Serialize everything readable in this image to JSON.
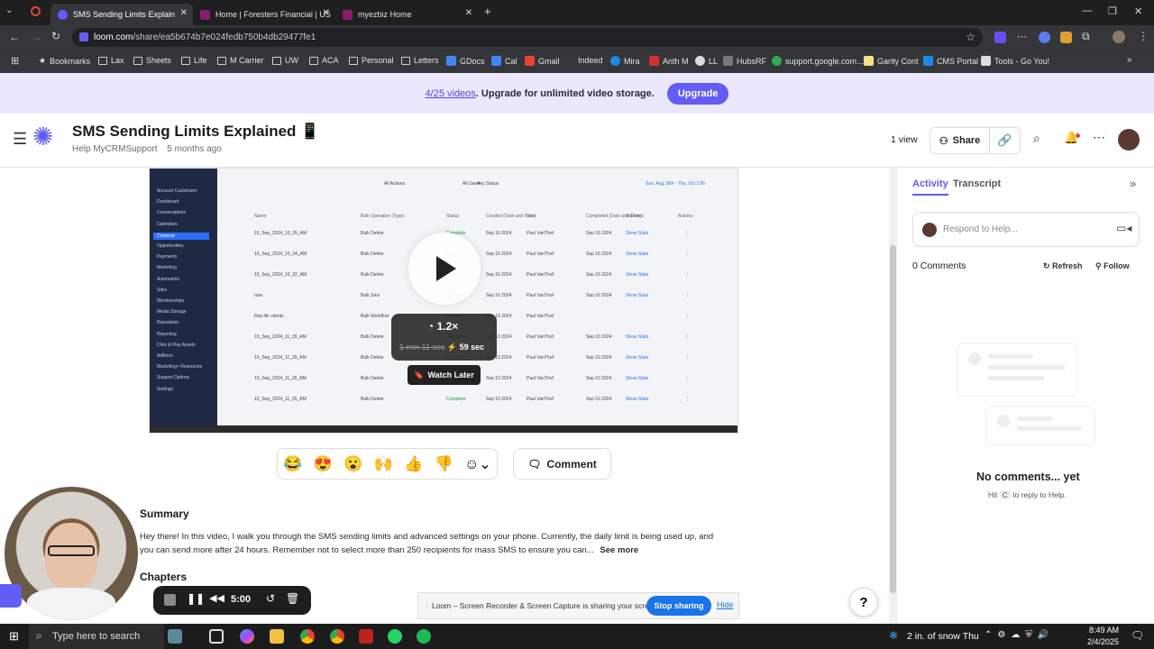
{
  "browser": {
    "tabs": [
      {
        "title": "SMS Sending Limits Explain",
        "active": true
      },
      {
        "title": "Home | Foresters Financial | US",
        "active": false
      },
      {
        "title": "myezbiz Home",
        "active": false
      }
    ],
    "url_host": "loom.com",
    "url_path": "/share/ea5b674b7e024fedb750b4db29477fe1",
    "bookmarks": [
      "Bookmarks",
      "Lax",
      "Sheets",
      "Life",
      "M Carrier",
      "UW",
      "ACA",
      "Personal",
      "Letters",
      "GDocs",
      "Cal",
      "Gmail",
      "Indeed",
      "Mira",
      "Anth M",
      "LL",
      "HubsRF",
      "support.google.com...",
      "Garity Cont",
      "CMS Portal",
      "Tools - Go You!"
    ]
  },
  "banner": {
    "count": "4/25 videos",
    "message": ". Upgrade for unlimited video storage.",
    "upgrade_label": "Upgrade"
  },
  "header": {
    "title": "SMS Sending Limits Explained 📱",
    "author": "Help MyCRMSupport",
    "age": "5 months ago",
    "views": "1 view",
    "share_label": "Share"
  },
  "video": {
    "speed": "1.2×",
    "original_time": "1 min 11 sec",
    "new_time": "59 sec",
    "watch_later": "Watch Later",
    "sidebar_items": [
      "Account Customizer",
      "Dashboard",
      "Conversations",
      "Calendars",
      "Contacts",
      "Opportunities",
      "Payments",
      "Marketing",
      "Automation",
      "Sites",
      "Memberships",
      "Media Storage",
      "Reputation",
      "Reporting",
      "Click & Play Assets",
      "AdBoon",
      "Marketing+ Resources",
      "Support Options",
      "Settings"
    ],
    "columns": [
      "Name",
      "Bulk Operation (Type)",
      "Status",
      "Created (Date and Time)",
      "User",
      "Completed (Date and Time)",
      "Statistics",
      "Actions"
    ],
    "filters": [
      "All Actions",
      "All Users",
      "Any Status",
      "Sun, Aug 18th - Thu, Oct 17th"
    ],
    "rows": [
      {
        "name": "16_Sep_2024_10_35_AM",
        "op": "Bulk Delete",
        "status": "Complete",
        "created": "Sep 16 2024",
        "user": "Paul VanThof",
        "completed": "Sep 16 2024",
        "stats": "Show Stats"
      },
      {
        "name": "16_Sep_2024_10_34_AM",
        "op": "Bulk Delete",
        "status": "Complete",
        "created": "Sep 16 2024",
        "user": "Paul VanThof",
        "completed": "Sep 16 2024",
        "stats": "Show Stats"
      },
      {
        "name": "16_Sep_2024_10_32_AM",
        "op": "Bulk Delete",
        "status": "Complete",
        "created": "Sep 16 2024",
        "user": "Paul VanThof",
        "completed": "Sep 16 2024",
        "stats": "Show Stats"
      },
      {
        "name": "now",
        "op": "Bulk Sms",
        "status": "Complete",
        "created": "Sep 16 2024",
        "user": "Paul VanThof",
        "completed": "Sep 16 2024",
        "stats": "Show Stats"
      },
      {
        "name": "Rep life clients",
        "op": "Bulk Workflow",
        "status": "Queued",
        "created": "Sep 16 2024",
        "user": "Paul VanThof",
        "completed": "",
        "stats": ""
      },
      {
        "name": "10_Sep_2024_11_29_AM",
        "op": "Bulk Delete",
        "status": "Complete",
        "created": "Sep 10 2024",
        "user": "Paul VanThof",
        "completed": "Sep 10 2024",
        "stats": "Show Stats"
      },
      {
        "name": "10_Sep_2024_11_29_AM",
        "op": "Bulk Delete",
        "status": "Complete",
        "created": "Sep 10 2024",
        "user": "Paul VanThof",
        "completed": "Sep 10 2024",
        "stats": "Show Stats"
      },
      {
        "name": "10_Sep_2024_11_26_AM",
        "op": "Bulk Delete",
        "status": "Complete",
        "created": "Sep 10 2024",
        "user": "Paul VanThof",
        "completed": "Sep 10 2024",
        "stats": "Show Stats"
      },
      {
        "name": "10_Sep_2024_11_25_AM",
        "op": "Bulk Delete",
        "status": "Complete",
        "created": "Sep 10 2024",
        "user": "Paul VanThof",
        "completed": "Sep 10 2024",
        "stats": "Show Stats"
      }
    ]
  },
  "reactions": [
    "😂",
    "😍",
    "😮",
    "🙌",
    "👍",
    "👎"
  ],
  "comment_label": "Comment",
  "summary": {
    "heading": "Summary",
    "text": "Hey there! In this video, I walk you through the SMS sending limits and advanced settings on your phone. Currently, the daily limit is being used up, and you can send more after 24 hours. Remember not to select more than 250 recipients for mass SMS to ensure you can...",
    "see_more": "See more"
  },
  "chapters": {
    "heading": "Chapters"
  },
  "panel": {
    "tabs": [
      "Activity",
      "Transcript"
    ],
    "respond_placeholder": "Respond to Help...",
    "comments_count": "0 Comments",
    "refresh": "Refresh",
    "follow": "Follow",
    "empty_title": "No comments... yet",
    "empty_hint_pre": "Hit",
    "empty_hint_key": "C",
    "empty_hint_post": "to reply to Help."
  },
  "recorder": {
    "time": "5:00"
  },
  "sharebar": {
    "message": "Loom – Screen Recorder & Screen Capture is sharing your screen.",
    "stop": "Stop sharing",
    "hide": "Hide"
  },
  "help_label": "?",
  "taskbar": {
    "search_placeholder": "Type here to search",
    "weather": "2 in. of snow Thu",
    "time": "8:49 AM",
    "date": "2/4/2025"
  },
  "colors": {
    "accent": "#625df5",
    "banner_bg": "#ebe8fd",
    "taskbar": "#1c1c1c"
  }
}
